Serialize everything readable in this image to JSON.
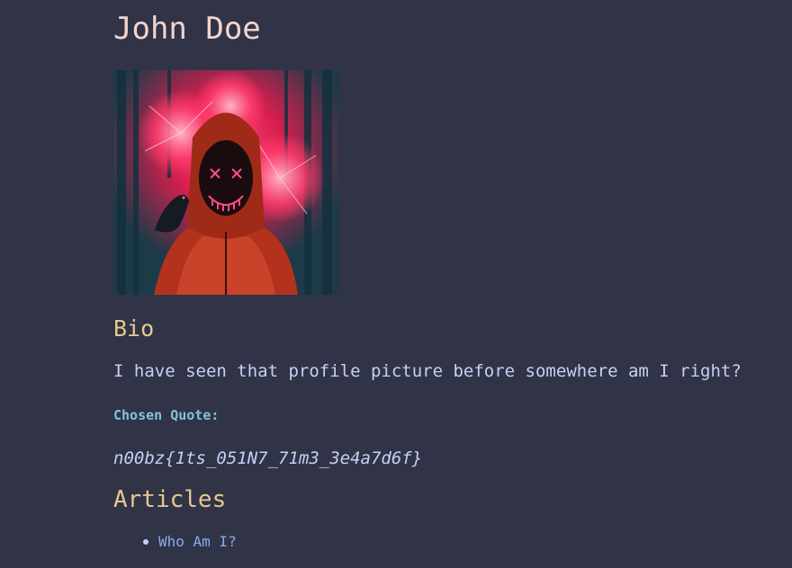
{
  "profile": {
    "name": "John Doe",
    "avatar_description": "hooded figure with glowing neon mask"
  },
  "bio": {
    "heading": "Bio",
    "text": "I have seen that profile picture before somewhere am I right?"
  },
  "quote": {
    "label": "Chosen Quote:",
    "text": "n00bz{1ts_051N7_71m3_3e4a7d6f}"
  },
  "articles": {
    "heading": "Articles",
    "items": [
      {
        "title": "Who Am I?"
      }
    ]
  },
  "colors": {
    "background": "#303446",
    "name": "#f2d5cf",
    "heading": "#e5c890",
    "label": "#85c1dc",
    "text": "#c6d0f5",
    "link": "#8caaee"
  }
}
